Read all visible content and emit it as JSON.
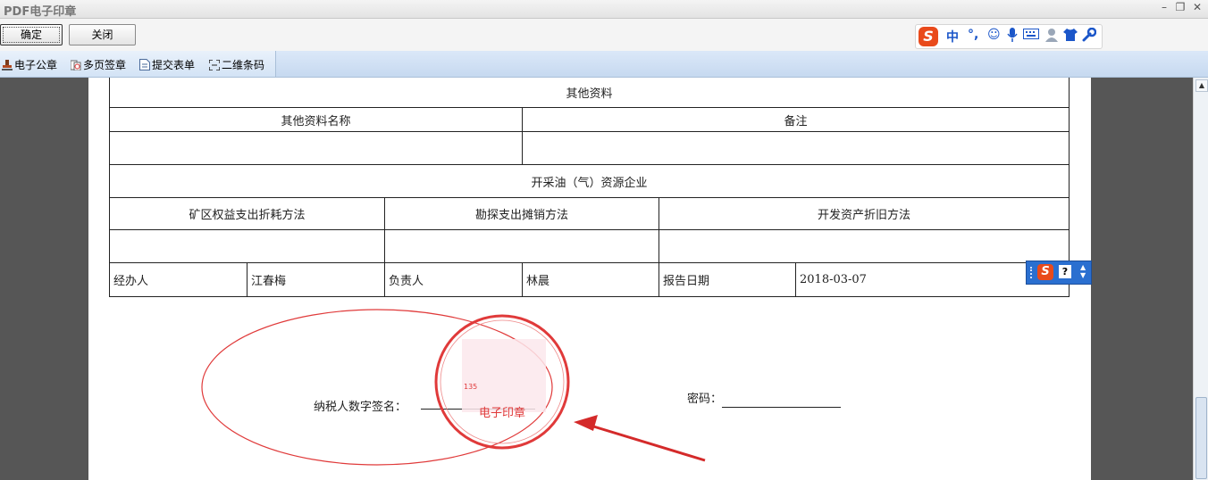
{
  "window": {
    "title": "PDF电子印章",
    "minimize": "–",
    "restore": "❐",
    "close": "✕"
  },
  "buttons": {
    "ok": "确定",
    "close": "关闭"
  },
  "ime_toolbar": {
    "logo": "S",
    "mode": "中",
    "punct": "°,",
    "emoji": "☺",
    "voice": "🎤",
    "keyboard": "⌨",
    "user": "👤",
    "skin": "👕",
    "tools": "🔧"
  },
  "tools": [
    {
      "label": "电子公章",
      "icon": "stamp-icon"
    },
    {
      "label": "多页签章",
      "icon": "multi-page-seal-icon"
    },
    {
      "label": "提交表单",
      "icon": "submit-form-icon"
    },
    {
      "label": "二维条码",
      "icon": "qr-code-icon"
    }
  ],
  "form": {
    "section_other": "其他资料",
    "col_other_name": "其他资料名称",
    "col_remark": "备注",
    "section_mining": "开采油（气）资源企业",
    "col_depletion": "矿区权益支出折耗方法",
    "col_exploration": "勘探支出摊销方法",
    "col_depreciation": "开发资产折旧方法",
    "agent_label": "经办人",
    "agent_value": "江春梅",
    "manager_label": "负责人",
    "manager_value": "林晨",
    "date_label": "报告日期",
    "date_value": "2018-03-07"
  },
  "signature": {
    "label": "纳税人数字签名：",
    "password_label": "密码："
  },
  "seal": {
    "text": "电子印章",
    "fragment": "135"
  },
  "floating_ime": {
    "logo": "S",
    "help": "?"
  },
  "colors": {
    "seal_red": "#e03a3a",
    "arrow_red": "#d42a2a",
    "toolbar_blue": "#c6d9f0",
    "viewer_gray": "#565656"
  }
}
